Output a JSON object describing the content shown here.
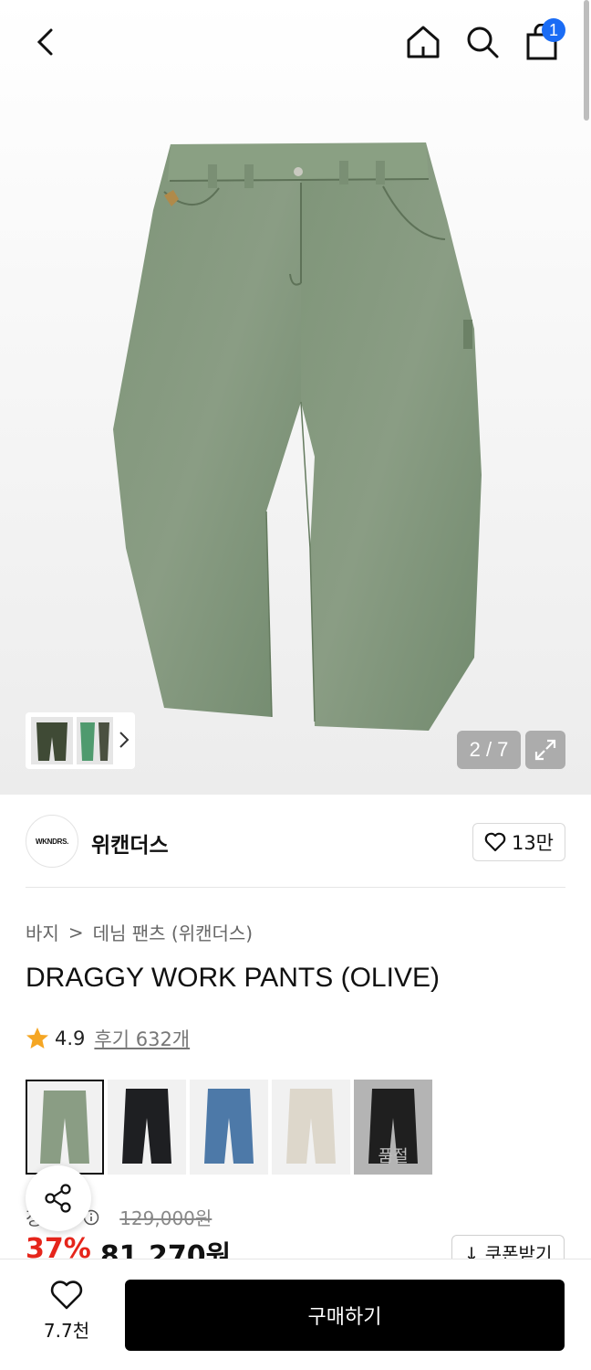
{
  "header": {
    "back_icon": "chevron-left-icon",
    "home_icon": "home-icon",
    "search_icon": "search-icon",
    "cart_icon": "shopping-bag-icon",
    "cart_count": "1",
    "badge_color": "#1a6cf5"
  },
  "gallery": {
    "counter": "2 / 7",
    "expand_icon": "expand-icon"
  },
  "brand": {
    "logo_text": "WKNDRS.",
    "name": "위캔더스",
    "likes": "13만"
  },
  "breadcrumb": {
    "category": "바지",
    "separator": ">",
    "subcategory": "데님 팬츠 (위캔더스)"
  },
  "product": {
    "title": "DRAGGY WORK PANTS (OLIVE)",
    "rating": "4.9",
    "reviews": "후기 632개",
    "star_color": "#f5a623"
  },
  "swatches": {
    "soldout_label": "품절"
  },
  "price": {
    "label": "정상가",
    "info_icon": "info-icon",
    "original": "129,000원",
    "discount_pct": "37%",
    "sale": "81,270원",
    "discount_color": "#e5251b",
    "coupon_label": "↓ 쿠폰받기"
  },
  "bottom_bar": {
    "wish_count": "7.7천",
    "buy_label": "구매하기"
  }
}
